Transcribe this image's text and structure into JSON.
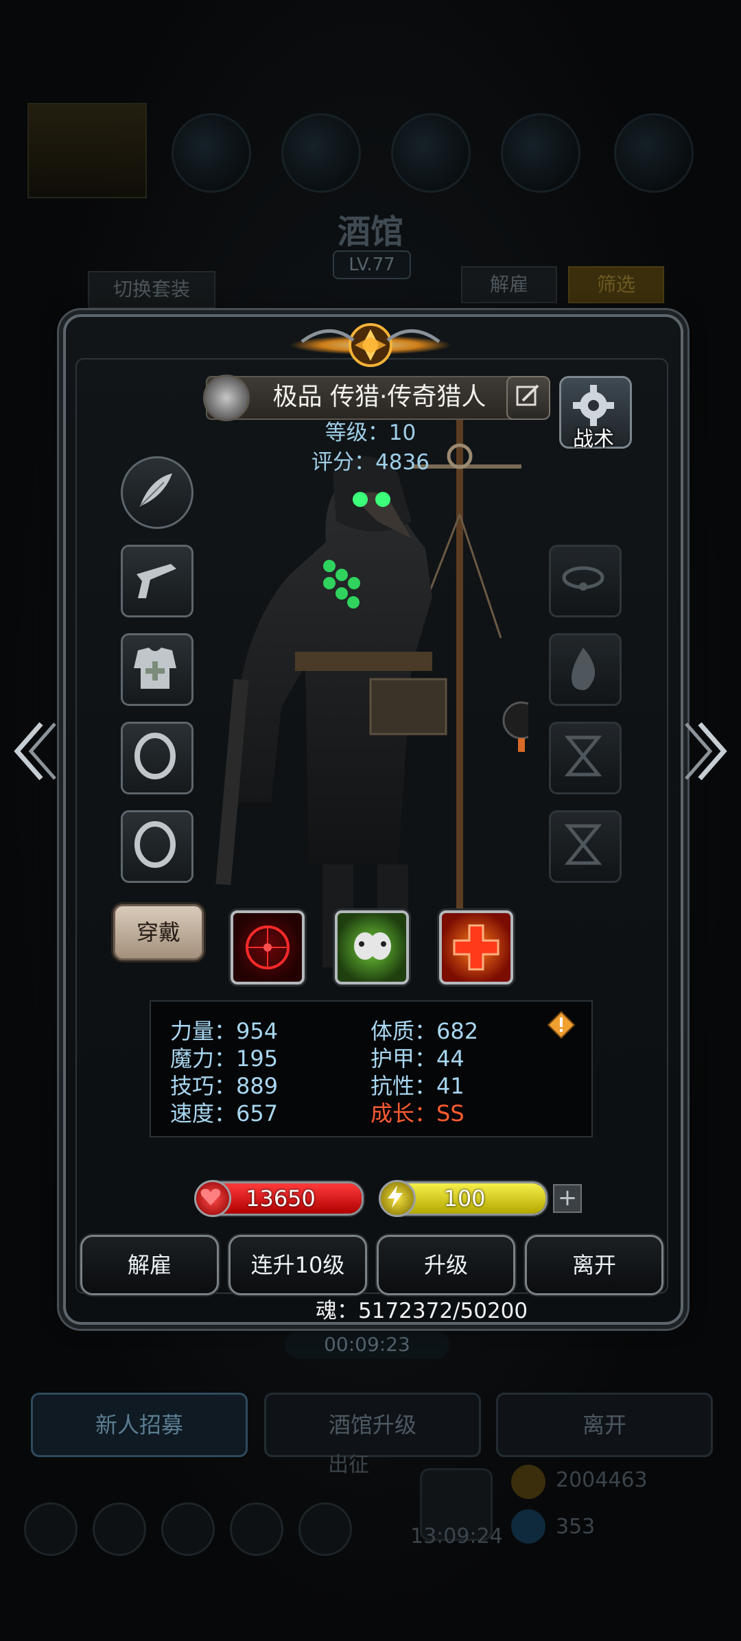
{
  "background": {
    "title": "酒馆",
    "level": "LV.77",
    "switch_outfit": "切换套装",
    "dismiss": "解雇",
    "filter": "筛选",
    "timer": "00:09:23",
    "bottom_buttons": [
      "新人招募",
      "酒馆升级",
      "离开"
    ],
    "expedition": "出征",
    "clock": "13:09:24",
    "gold": "2004463",
    "gems": "353"
  },
  "hero": {
    "name": "极品 传猎·传奇猎人",
    "level_label": "等级：10",
    "score_label": "评分：4836",
    "tactics_label": "战术",
    "wear_label": "穿戴",
    "stats": {
      "strength": "力量：954",
      "magic": "魔力：195",
      "skill": "技巧：889",
      "speed": "速度：657",
      "constitution": "体质：682",
      "armor": "护甲：44",
      "resistance": "抗性：41",
      "growth": "成长：SS"
    },
    "hp": "13650",
    "energy": "100",
    "energy_fraction": 1.0,
    "hp_fraction": 1.0
  },
  "actions": {
    "dismiss": "解雇",
    "level10": "连升10级",
    "upgrade": "升级",
    "leave": "离开"
  },
  "soul": "魂：5172372/50200",
  "icons": {
    "left_slots": [
      "quill-icon",
      "pistol-icon",
      "armor-icon",
      "ring-icon",
      "ring-icon"
    ],
    "right_slots": [
      "amulet-icon",
      "flame-icon",
      "hourglass-icon",
      "hourglass-icon"
    ],
    "skills": [
      "crosshair-skill-icon",
      "skull-poison-skill-icon",
      "heal-cross-skill-icon"
    ]
  }
}
